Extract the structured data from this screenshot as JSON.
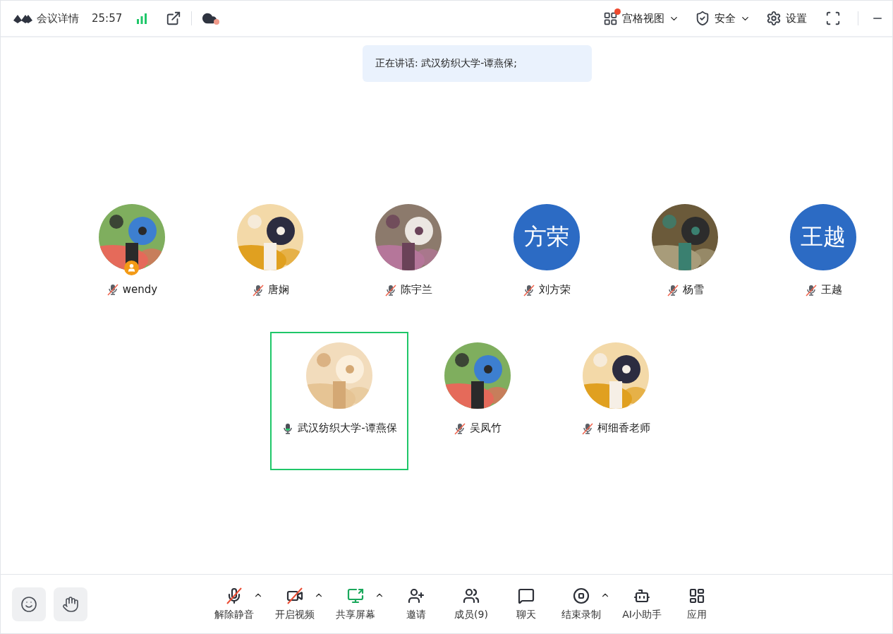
{
  "top_bar": {
    "title": "会议详情",
    "duration": "25:57",
    "recording": true,
    "view": {
      "label": "宫格视图",
      "dot": true
    },
    "security": {
      "label": "安全"
    },
    "settings": {
      "label": "设置"
    }
  },
  "speaking": "正在讲话: 武汉纺织大学-谭燕保;",
  "participants": [
    {
      "name": "wendy",
      "muted": true,
      "selected": false,
      "host": true
    },
    {
      "name": "唐娴",
      "muted": true,
      "selected": false,
      "host": false
    },
    {
      "name": "陈宇兰",
      "muted": true,
      "selected": false,
      "host": false
    },
    {
      "name": "刘方荣",
      "muted": true,
      "selected": false,
      "host": false,
      "avatar": {
        "kind": "initials",
        "text": "方荣"
      }
    },
    {
      "name": "杨雪",
      "muted": true,
      "selected": false,
      "host": false
    },
    {
      "name": "王越",
      "muted": true,
      "selected": false,
      "host": false,
      "avatar": {
        "kind": "initials",
        "text": "王越"
      }
    },
    {
      "name": "武汉纺织大学-谭燕保",
      "muted": false,
      "selected": true,
      "host": false
    },
    {
      "name": "吴凤竹",
      "muted": true,
      "selected": false,
      "host": false
    },
    {
      "name": "柯细香老师",
      "muted": true,
      "selected": false,
      "host": false
    }
  ],
  "toolbar": [
    {
      "kind": "mic",
      "label": "解除静音",
      "crossed": true,
      "caret": true
    },
    {
      "kind": "video",
      "label": "开启视频",
      "crossed": true,
      "caret": true
    },
    {
      "kind": "share",
      "label": "共享屏幕",
      "crossed": false,
      "caret": true
    },
    {
      "kind": "invite",
      "label": "邀请",
      "crossed": false,
      "caret": false
    },
    {
      "kind": "members",
      "label": "成员(9)",
      "crossed": false,
      "caret": false
    },
    {
      "kind": "chat",
      "label": "聊天",
      "crossed": false,
      "caret": false
    },
    {
      "kind": "record",
      "label": "结束录制",
      "crossed": false,
      "caret": true
    },
    {
      "kind": "assistant",
      "label": "AI小助手",
      "crossed": false,
      "caret": false
    },
    {
      "kind": "apps",
      "label": "应用",
      "crossed": false,
      "caret": false
    }
  ]
}
